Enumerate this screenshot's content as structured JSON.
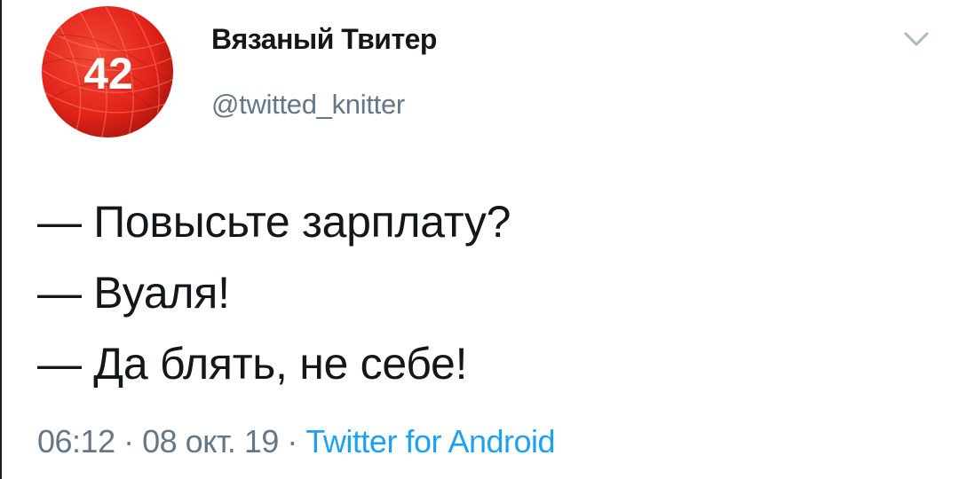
{
  "tweet": {
    "avatar": {
      "badge_number": "42",
      "ball_color": "#e2231a"
    },
    "author": {
      "display_name": "Вязаный Твитер",
      "handle": "@twitted_knitter"
    },
    "menu_icon": "chevron-down-icon",
    "lines": [
      "— Повысьте зарплату?",
      "— Вуаля!",
      "— Да блять, не себе!"
    ],
    "meta": {
      "time": "06:12",
      "separator": "·",
      "date": "08 окт. 19",
      "source": "Twitter for Android"
    },
    "colors": {
      "text": "#14171a",
      "secondary": "#657786",
      "link": "#1da1f2"
    }
  }
}
